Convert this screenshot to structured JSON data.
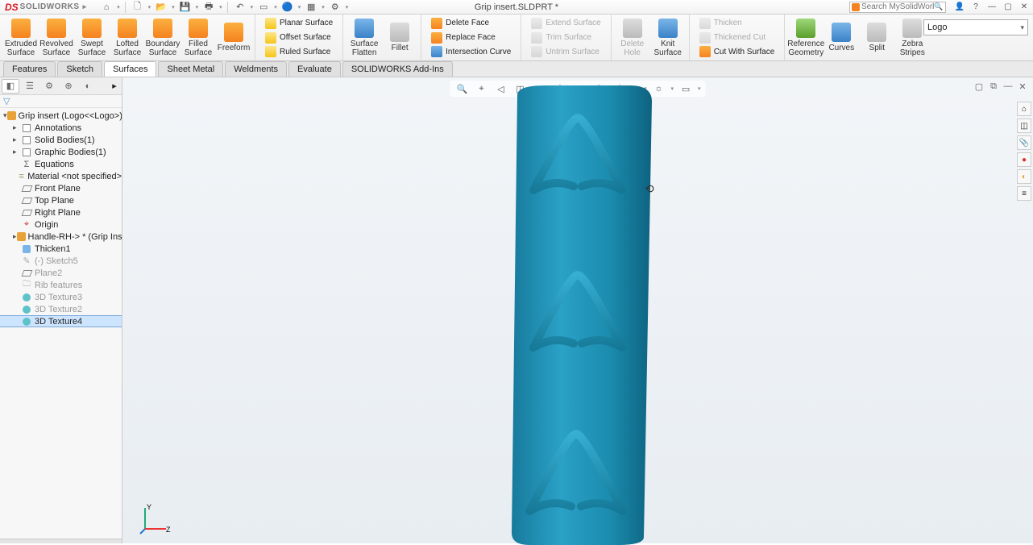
{
  "app": {
    "brand": "SOLIDWORKS",
    "doc_title": "Grip insert.SLDPRT *",
    "search_placeholder": "Search MySolidWorks"
  },
  "qat": [
    {
      "name": "home-icon",
      "glyph": "⌂"
    },
    {
      "name": "new-icon",
      "glyph": "🗋"
    },
    {
      "name": "open-icon",
      "glyph": "📂"
    },
    {
      "name": "save-icon",
      "glyph": "💾"
    },
    {
      "name": "print-icon",
      "glyph": "🖶"
    },
    {
      "name": "undo-icon",
      "glyph": "↶"
    },
    {
      "name": "select-icon",
      "glyph": "▭"
    },
    {
      "name": "rebuild-icon",
      "glyph": "🔵"
    },
    {
      "name": "options-icon",
      "glyph": "▦"
    },
    {
      "name": "settings-icon",
      "glyph": "⚙"
    }
  ],
  "titlebar_right": [
    {
      "name": "login-icon",
      "glyph": "👤"
    },
    {
      "name": "help-icon",
      "glyph": "?"
    },
    {
      "name": "minimize-icon",
      "glyph": "—"
    },
    {
      "name": "restore-icon",
      "glyph": "▢"
    },
    {
      "name": "close-icon",
      "glyph": "✕"
    }
  ],
  "ribbon": {
    "big": [
      {
        "name": "extruded-surface",
        "label": "Extruded\nSurface",
        "color": "c-orange"
      },
      {
        "name": "revolved-surface",
        "label": "Revolved\nSurface",
        "color": "c-orange"
      },
      {
        "name": "swept-surface",
        "label": "Swept\nSurface",
        "color": "c-orange"
      },
      {
        "name": "lofted-surface",
        "label": "Lofted\nSurface",
        "color": "c-orange"
      },
      {
        "name": "boundary-surface",
        "label": "Boundary\nSurface",
        "color": "c-orange"
      },
      {
        "name": "filled-surface",
        "label": "Filled\nSurface",
        "color": "c-orange"
      },
      {
        "name": "freeform",
        "label": "Freeform",
        "color": "c-orange"
      }
    ],
    "col1": [
      {
        "name": "planar-surface",
        "label": "Planar Surface",
        "disabled": false,
        "color": "c-yellow"
      },
      {
        "name": "offset-surface",
        "label": "Offset Surface",
        "disabled": false,
        "color": "c-yellow"
      },
      {
        "name": "ruled-surface",
        "label": "Ruled Surface",
        "disabled": false,
        "color": "c-yellow"
      }
    ],
    "mid1": [
      {
        "name": "surface-flatten",
        "label": "Surface\nFlatten",
        "color": "c-blue"
      },
      {
        "name": "fillet",
        "label": "Fillet",
        "color": "c-gray"
      }
    ],
    "col2": [
      {
        "name": "delete-face",
        "label": "Delete Face",
        "disabled": false,
        "color": "c-orange"
      },
      {
        "name": "replace-face",
        "label": "Replace Face",
        "disabled": false,
        "color": "c-orange"
      },
      {
        "name": "intersection-curve",
        "label": "Intersection Curve",
        "disabled": false,
        "color": "c-blue"
      }
    ],
    "col3": [
      {
        "name": "extend-surface",
        "label": "Extend Surface",
        "disabled": true,
        "color": "c-gray"
      },
      {
        "name": "trim-surface",
        "label": "Trim Surface",
        "disabled": true,
        "color": "c-gray"
      },
      {
        "name": "untrim-surface",
        "label": "Untrim Surface",
        "disabled": true,
        "color": "c-gray"
      }
    ],
    "mid2": [
      {
        "name": "delete-hole",
        "label": "Delete\nHole",
        "color": "c-gray",
        "disabled": true
      },
      {
        "name": "knit-surface",
        "label": "Knit\nSurface",
        "color": "c-blue"
      }
    ],
    "col4": [
      {
        "name": "thicken",
        "label": "Thicken",
        "disabled": true,
        "color": "c-gray"
      },
      {
        "name": "thickened-cut",
        "label": "Thickened Cut",
        "disabled": true,
        "color": "c-gray"
      },
      {
        "name": "cut-with-surface",
        "label": "Cut With Surface",
        "disabled": false,
        "color": "c-orange"
      }
    ],
    "right": [
      {
        "name": "reference-geometry",
        "label": "Reference\nGeometry",
        "color": "c-green"
      },
      {
        "name": "curves",
        "label": "Curves",
        "color": "c-blue"
      },
      {
        "name": "split",
        "label": "Split",
        "color": "c-gray"
      },
      {
        "name": "zebra-stripes",
        "label": "Zebra\nStripes",
        "color": "c-gray"
      }
    ],
    "dropdown": "Logo"
  },
  "tabs": [
    {
      "name": "tab-features",
      "label": "Features",
      "active": false
    },
    {
      "name": "tab-sketch",
      "label": "Sketch",
      "active": false
    },
    {
      "name": "tab-surfaces",
      "label": "Surfaces",
      "active": true
    },
    {
      "name": "tab-sheet-metal",
      "label": "Sheet Metal",
      "active": false
    },
    {
      "name": "tab-weldments",
      "label": "Weldments",
      "active": false
    },
    {
      "name": "tab-evaluate",
      "label": "Evaluate",
      "active": false
    },
    {
      "name": "tab-addins",
      "label": "SOLIDWORKS Add-Ins",
      "active": false
    }
  ],
  "panel_tabs": [
    {
      "name": "fm-tab",
      "glyph": "◧",
      "active": true
    },
    {
      "name": "pm-tab",
      "glyph": "☰",
      "active": false
    },
    {
      "name": "cfg-tab",
      "glyph": "⚙",
      "active": false
    },
    {
      "name": "dim-tab",
      "glyph": "⊕",
      "active": false
    },
    {
      "name": "disp-tab",
      "glyph": "◐",
      "active": false
    }
  ],
  "tree": [
    {
      "name": "root",
      "label": "Grip insert  (Logo<<Logo>)-> *",
      "indent": 0,
      "twisty": "▾",
      "color": "#e8a238"
    },
    {
      "name": "annotations",
      "label": "Annotations",
      "indent": 1,
      "twisty": "▸",
      "icon": "box"
    },
    {
      "name": "solid-bodies",
      "label": "Solid Bodies(1)",
      "indent": 1,
      "twisty": "▸",
      "icon": "box"
    },
    {
      "name": "graphic-bodies",
      "label": "Graphic Bodies(1)",
      "indent": 1,
      "twisty": "▸",
      "icon": "box"
    },
    {
      "name": "equations",
      "label": "Equations",
      "indent": 1,
      "twisty": "",
      "icon": "sigma"
    },
    {
      "name": "material",
      "label": "Material <not specified>",
      "indent": 1,
      "twisty": "",
      "icon": "mat"
    },
    {
      "name": "front-plane",
      "label": "Front Plane",
      "indent": 1,
      "twisty": "",
      "icon": "plane"
    },
    {
      "name": "top-plane",
      "label": "Top Plane",
      "indent": 1,
      "twisty": "",
      "icon": "plane"
    },
    {
      "name": "right-plane",
      "label": "Right Plane",
      "indent": 1,
      "twisty": "",
      "icon": "plane"
    },
    {
      "name": "origin",
      "label": "Origin",
      "indent": 1,
      "twisty": "",
      "icon": "origin"
    },
    {
      "name": "handle-rh",
      "label": "Handle-RH-> * (Grip Insert)",
      "indent": 1,
      "twisty": "▸",
      "color": "#e8a238"
    },
    {
      "name": "thicken1",
      "label": "Thicken1",
      "indent": 1,
      "twisty": "",
      "icon": "feat"
    },
    {
      "name": "sketch5",
      "label": "(-) Sketch5",
      "indent": 1,
      "twisty": "",
      "icon": "sketch",
      "dim": true
    },
    {
      "name": "plane2",
      "label": "Plane2",
      "indent": 1,
      "twisty": "",
      "icon": "plane",
      "dim": true
    },
    {
      "name": "rib-features",
      "label": "Rib features",
      "indent": 1,
      "twisty": "",
      "icon": "folder",
      "dim": true
    },
    {
      "name": "3dtex3",
      "label": "3D Texture3",
      "indent": 1,
      "twisty": "",
      "icon": "tex",
      "dim": true
    },
    {
      "name": "3dtex2",
      "label": "3D Texture2",
      "indent": 1,
      "twisty": "",
      "icon": "tex",
      "dim": true
    },
    {
      "name": "3dtex4",
      "label": "3D Texture4",
      "indent": 1,
      "twisty": "",
      "icon": "tex",
      "selected": true
    }
  ],
  "hud": [
    {
      "name": "zoom-fit-icon",
      "glyph": "🔍"
    },
    {
      "name": "zoom-area-icon",
      "glyph": "⌖"
    },
    {
      "name": "prev-view-icon",
      "glyph": "◁"
    },
    {
      "name": "section-view-icon",
      "glyph": "◫"
    },
    {
      "name": "view-orient-icon",
      "glyph": "▣"
    },
    {
      "name": "display-style-icon",
      "glyph": "◧"
    },
    {
      "name": "hide-show-icon",
      "glyph": "👁"
    },
    {
      "name": "appearance-icon",
      "glyph": "●"
    },
    {
      "name": "scene-icon",
      "glyph": "☼"
    },
    {
      "name": "view-settings-icon",
      "glyph": "▭"
    }
  ],
  "viewport_corner": [
    {
      "name": "vp-restore-icon",
      "glyph": "▢"
    },
    {
      "name": "vp-link-icon",
      "glyph": "⧉"
    },
    {
      "name": "vp-min-icon",
      "glyph": "—"
    },
    {
      "name": "vp-close-icon",
      "glyph": "✕"
    }
  ],
  "rightbar": [
    {
      "name": "rb-home",
      "glyph": "⌂"
    },
    {
      "name": "rb-cube",
      "glyph": "◫"
    },
    {
      "name": "rb-clip",
      "glyph": "📎"
    },
    {
      "name": "rb-appear",
      "glyph": "●",
      "color": "#d33"
    },
    {
      "name": "rb-decal",
      "glyph": "◐",
      "color": "#e8a238"
    },
    {
      "name": "rb-custom",
      "glyph": "≡"
    }
  ],
  "triad": {
    "x": "Z",
    "y": "Y"
  }
}
